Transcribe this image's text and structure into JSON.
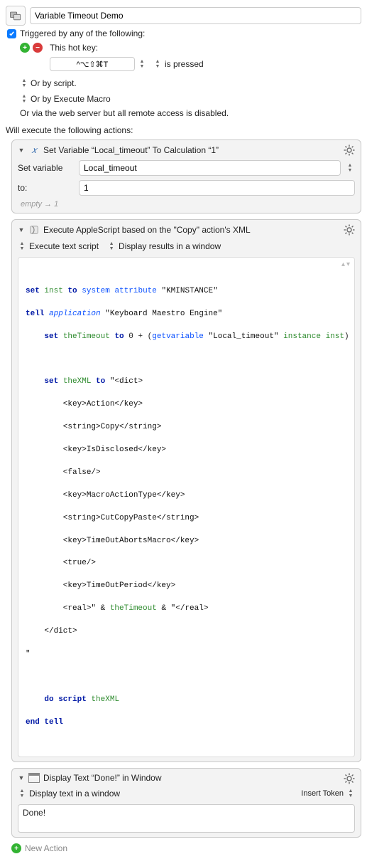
{
  "title": "Variable Timeout Demo",
  "trigger_heading": "Triggered by any of the following:",
  "hotkey_label": "This hot key:",
  "hotkey_value": "^⌥⇧⌘T",
  "hotkey_state": "is pressed",
  "or_script": "Or by script.",
  "or_execute_macro": "Or by Execute Macro",
  "or_webserver": "Or via the web server but all remote access is disabled.",
  "actions_heading": "Will execute the following actions:",
  "action1": {
    "title": "Set Variable “Local_timeout” To Calculation “1”",
    "set_variable_label": "Set variable",
    "variable_name": "Local_timeout",
    "to_label": "to:",
    "to_value": "1",
    "hint_prefix": "empty",
    "hint_arrow": "→",
    "hint_value": "1"
  },
  "action2": {
    "title": "Execute AppleScript based on the \"Copy\" action's XML",
    "mode_label": "Execute text script",
    "result_label": "Display results in a window",
    "code": {
      "l1a": "set",
      "l1b": "inst",
      "l1c": "to",
      "l1d": "system attribute",
      "l1e": "\"KMINSTANCE\"",
      "l2a": "tell",
      "l2b": "application",
      "l2c": "\"Keyboard Maestro Engine\"",
      "l3a": "set",
      "l3b": "theTimeout",
      "l3c": "to",
      "l3d": "0 + (",
      "l3e": "getvariable",
      "l3f": "\"Local_timeout\"",
      "l3g": "instance",
      "l3h": "inst",
      "l3i": ")",
      "l5a": "set",
      "l5b": "theXML",
      "l5c": "to",
      "l5d": "\"<dict>",
      "l6": "        <key>Action</key>",
      "l7": "        <string>Copy</string>",
      "l8": "        <key>IsDisclosed</key>",
      "l9": "        <false/>",
      "l10": "        <key>MacroActionType</key>",
      "l11": "        <string>CutCopyPaste</string>",
      "l12": "        <key>TimeOutAbortsMacro</key>",
      "l13": "        <true/>",
      "l14": "        <key>TimeOutPeriod</key>",
      "l15a": "        <real>\" & ",
      "l15b": "theTimeout",
      "l15c": " & \"</real>",
      "l16": "    </dict>",
      "l17": "\"",
      "l18a": "do script",
      "l18b": "theXML",
      "l19": "end tell"
    }
  },
  "action3": {
    "title": "Display Text “Done!” in Window",
    "mode_label": "Display text in a window",
    "insert_token": "Insert Token",
    "text_value": "Done!"
  },
  "new_action": "New Action"
}
